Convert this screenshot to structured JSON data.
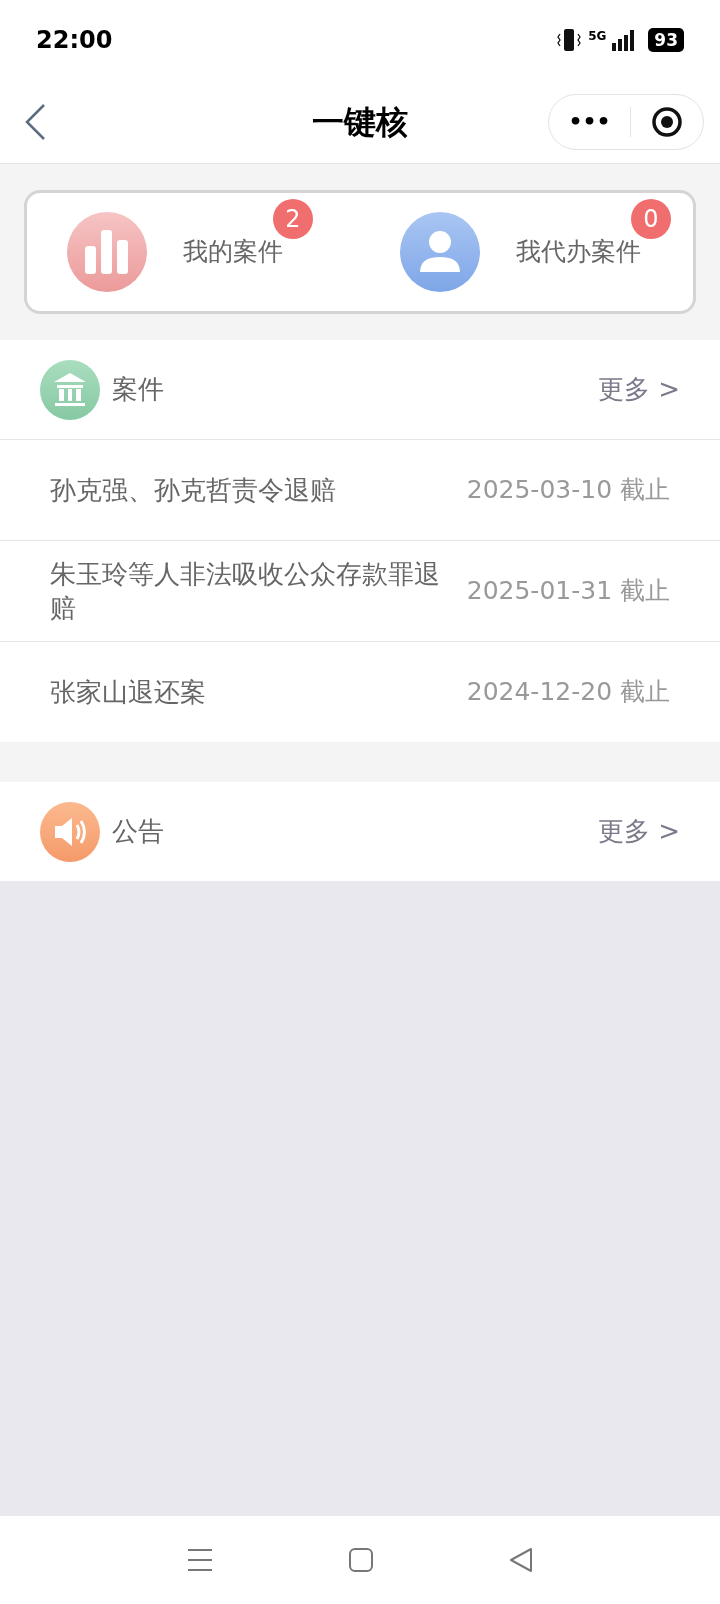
{
  "status_bar": {
    "time": "22:00",
    "network": "5G",
    "battery": "93"
  },
  "nav": {
    "title": "一键核",
    "menu": "•••"
  },
  "shortcuts": [
    {
      "kind": "chart",
      "label": "我的案件",
      "badge": "2"
    },
    {
      "kind": "person",
      "label": "我代办案件",
      "badge": "0"
    }
  ],
  "cases": {
    "title": "案件",
    "more": "更多 >",
    "rows": [
      {
        "title": "孙克强、孙克哲责令退赔",
        "deadline": "2025-03-10 截止"
      },
      {
        "title": "朱玉玲等人非法吸收公众存款罪退赔",
        "deadline": "2025-01-31 截止"
      },
      {
        "title": "张家山退还案",
        "deadline": "2024-12-20 截止"
      }
    ]
  },
  "notices": {
    "title": "公告",
    "more": "更多 >"
  }
}
